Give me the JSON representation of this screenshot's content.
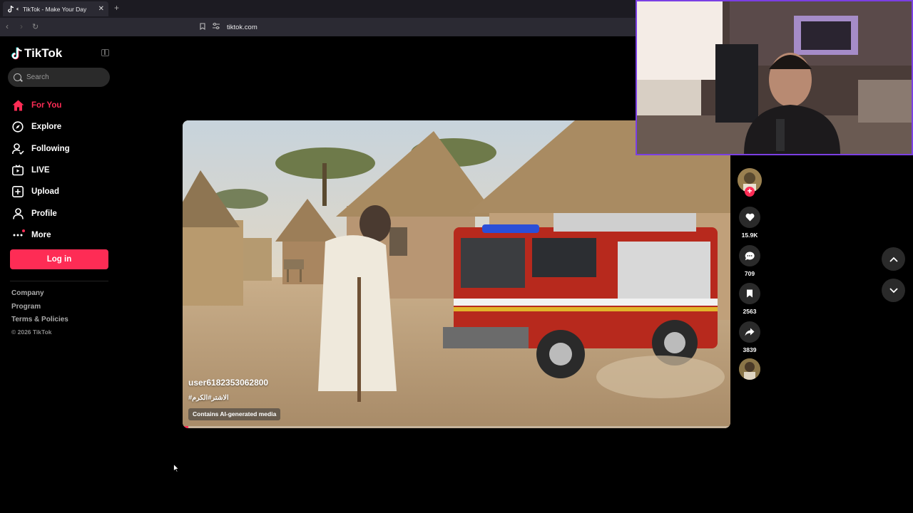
{
  "browser": {
    "tab_title": "TikTok - Make Your Day",
    "url": "tiktok.com",
    "new_tab_label": "+"
  },
  "sidebar": {
    "logo_text": "TikTok",
    "search_placeholder": "Search",
    "nav_items": [
      {
        "label": "For You",
        "icon": "home-icon",
        "active": true
      },
      {
        "label": "Explore",
        "icon": "compass-icon",
        "active": false
      },
      {
        "label": "Following",
        "icon": "following-icon",
        "active": false
      },
      {
        "label": "LIVE",
        "icon": "live-icon",
        "active": false
      },
      {
        "label": "Upload",
        "icon": "upload-icon",
        "active": false
      },
      {
        "label": "Profile",
        "icon": "profile-icon",
        "active": false
      },
      {
        "label": "More",
        "icon": "more-icon",
        "active": false
      }
    ],
    "login_label": "Log in",
    "footer_links": [
      "Company",
      "Program",
      "Terms & Policies"
    ],
    "copyright": "© 2026 TikTok"
  },
  "video": {
    "username": "user6182353062800",
    "caption": "#الاشتر#الكرم",
    "ai_label": "Contains AI-generated media",
    "progress": 0.01
  },
  "actions": {
    "likes": "15.9K",
    "comments": "709",
    "saves": "2563",
    "shares": "3839"
  },
  "colors": {
    "accent": "#fe2c55",
    "background": "#000000",
    "webcam_border": "#7b3fe4"
  }
}
